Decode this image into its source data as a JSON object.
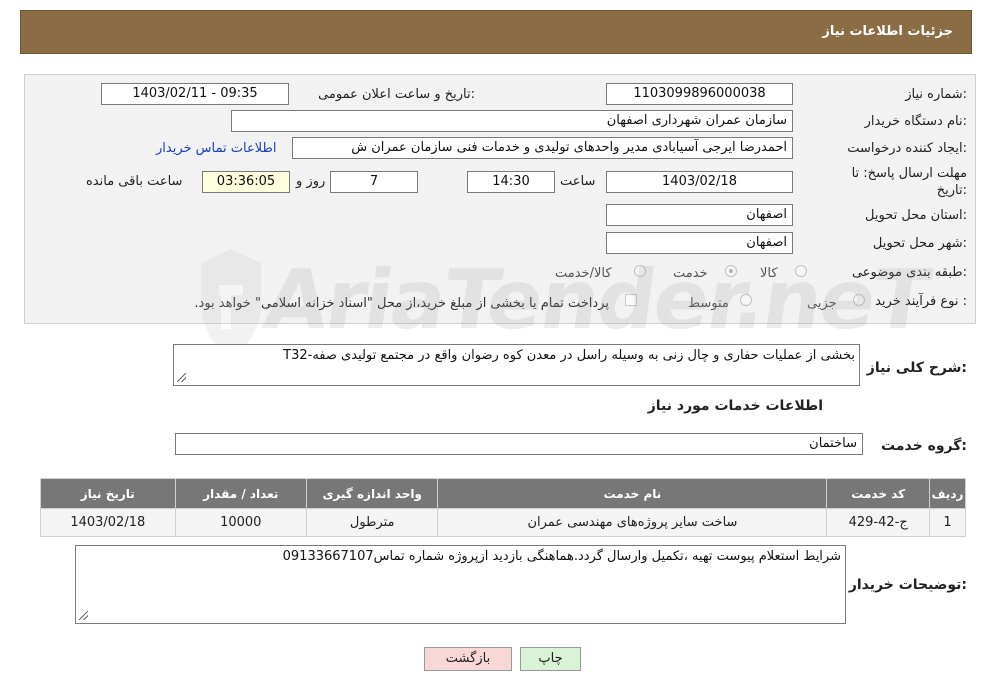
{
  "header": {
    "title": "جزئیات اطلاعات نیاز"
  },
  "form": {
    "need_number_label": "شماره نیاز:",
    "need_number": "1103099896000038",
    "announce_label": "تاریخ و ساعت اعلان عمومی:",
    "announce_value": "1403/02/11 - 09:35",
    "buyer_org_label": "نام دستگاه خریدار:",
    "buyer_org": "سازمان عمران شهرداری اصفهان",
    "creator_label": "ایجاد کننده درخواست:",
    "creator": "احمدرضا ایرجی آسیابادی مدیر واحدهای تولیدی و خدمات فنی سازمان عمران ش",
    "contact_link": "اطلاعات تماس خریدار",
    "deadline_label_1": "مهلت ارسال پاسخ: تا",
    "deadline_label_2": "تاریخ:",
    "deadline_date": "1403/02/18",
    "time_label": "ساعت",
    "deadline_time": "14:30",
    "days_value": "7",
    "days_label": "روز و",
    "remaining_value": "03:36:05",
    "remaining_label": "ساعت باقی مانده",
    "province_label": "استان محل تحویل:",
    "province": "اصفهان",
    "city_label": "شهر محل تحویل:",
    "city": "اصفهان",
    "category_label": "طبقه بندی موضوعی:",
    "category_options": [
      "کالا",
      "خدمت",
      "کالا/خدمت"
    ],
    "category_selected": "خدمت",
    "process_label": "نوع فرآیند خرید :",
    "process_options": [
      "جزیی",
      "متوسط"
    ],
    "payment_note": "پرداخت تمام یا بخشی از مبلغ خرید،از محل \"اسناد خزانه اسلامی\" خواهد بود."
  },
  "watermark": {
    "text": "AriaTender.neT"
  },
  "description": {
    "label": "شرح کلی نیاز:",
    "text": "بخشی از عملیات حفاری و چال زنی به وسیله راسل در معدن کوه رضوان واقع در مجتمع تولیدی صفه-T32"
  },
  "services": {
    "section_title": "اطلاعات خدمات مورد نیاز",
    "group_label": "گروه خدمت:",
    "group_value": "ساختمان",
    "columns": [
      "ردیف",
      "کد خدمت",
      "نام خدمت",
      "واحد اندازه گیری",
      "تعداد / مقدار",
      "تاریخ نیاز"
    ],
    "rows": [
      [
        "1",
        "ج-42-429",
        "ساخت سایر پروژه‌های مهندسی عمران",
        "مترطول",
        "10000",
        "1403/02/18"
      ]
    ]
  },
  "buyer_notes": {
    "label": "توضیحات خریدار:",
    "text": "شرایط استعلام پیوست تهیه ،تکمیل وارسال گردد.هماهنگی بازدید ازپروژه شماره تماس09133667107"
  },
  "buttons": {
    "print": "چاپ",
    "back": "بازگشت"
  },
  "colors": {
    "header_bg": "#8a6d45",
    "table_header_bg": "#777777",
    "link": "#1a3fbf"
  }
}
